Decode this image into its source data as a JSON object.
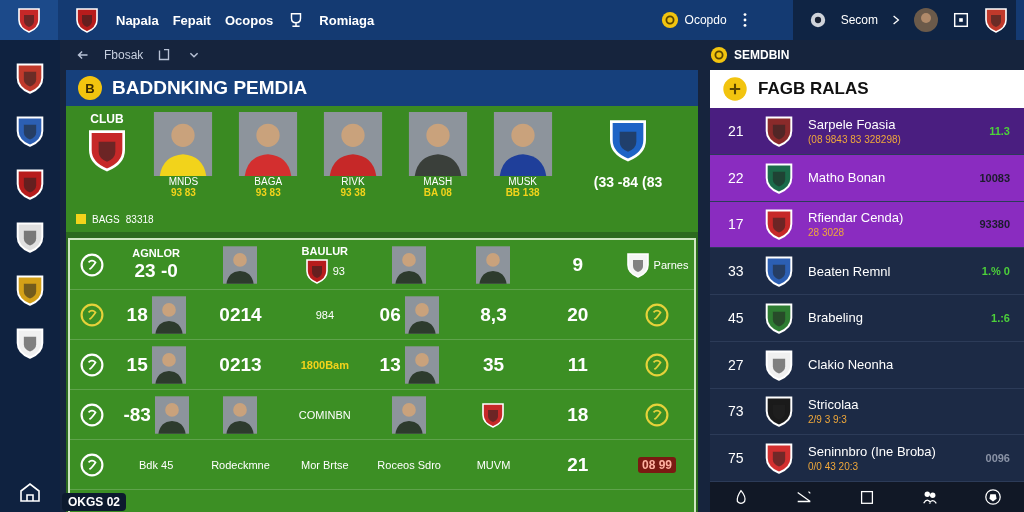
{
  "top_bar": {
    "nav": [
      "Napala",
      "Fepait",
      "Ocopos"
    ],
    "nav_extra": "Romiaga",
    "coins": "Ocopdo",
    "user": "Secom"
  },
  "sidebar": {
    "crests": [
      {
        "color": "#c0392b"
      },
      {
        "color": "#2c5fb3"
      },
      {
        "color": "#b71c1c"
      },
      {
        "color": "#e0e0e0"
      },
      {
        "color": "#d4a017"
      },
      {
        "color": "#f0f0f0"
      }
    ]
  },
  "sub_bar": {
    "title": "Fbosak",
    "right_label": "SEMDBIN"
  },
  "panel": {
    "title": "BADDNKING PEMDIA",
    "badge": "B",
    "hero": {
      "club_label": "CLUB",
      "club_crest": {
        "color": "#c62828"
      },
      "right_crest": {
        "color": "#1e63c6"
      },
      "footer_label": "BAGS",
      "footer_value": "83318",
      "score": "(33 -84 (83",
      "players": [
        {
          "name": "MNDS",
          "number": "93 83",
          "color": "#f2d31b"
        },
        {
          "name": "BAGA",
          "number": "93 83",
          "color": "#d32f2f"
        },
        {
          "name": "RIVK",
          "number": "93 38",
          "color": "#c62828"
        },
        {
          "name": "MASH",
          "number": "BA 08",
          "color": "#3a3f3a"
        },
        {
          "name": "MUSK",
          "number": "BB 138",
          "color": "#1f3f9a"
        }
      ]
    },
    "grid_rows": [
      [
        {
          "kind": "ring",
          "color": "#ffffff"
        },
        {
          "kind": "value",
          "caption": "AGNLOR",
          "text": "23 -0"
        },
        {
          "kind": "player"
        },
        {
          "kind": "crest",
          "caption": "BAULUR",
          "text": "93",
          "color": "#b71c1c"
        },
        {
          "kind": "player"
        },
        {
          "kind": "player"
        },
        {
          "kind": "value",
          "text": "9"
        },
        {
          "kind": "crest",
          "text": "Parnes",
          "color": "#f5f5f5"
        }
      ],
      [
        {
          "kind": "ring",
          "color": "#e6d23a"
        },
        {
          "kind": "player",
          "text": "18"
        },
        {
          "kind": "value",
          "text": "0214"
        },
        {
          "kind": "text",
          "text": "984"
        },
        {
          "kind": "player",
          "text": "06"
        },
        {
          "kind": "value",
          "text": "8,3"
        },
        {
          "kind": "value",
          "text": "20"
        },
        {
          "kind": "ring",
          "color": "#e6d23a"
        }
      ],
      [
        {
          "kind": "ring",
          "color": "#ffffff"
        },
        {
          "kind": "player",
          "text": "15"
        },
        {
          "kind": "value",
          "text": "0213"
        },
        {
          "kind": "note",
          "text": "1800Bam"
        },
        {
          "kind": "player",
          "text": "13"
        },
        {
          "kind": "value",
          "text": "35"
        },
        {
          "kind": "value",
          "text": "11"
        },
        {
          "kind": "ring",
          "color": "#e6d23a"
        }
      ],
      [
        {
          "kind": "ring",
          "color": "#ffffff"
        },
        {
          "kind": "player",
          "text": "-83"
        },
        {
          "kind": "player"
        },
        {
          "kind": "text",
          "text": "COMINBN"
        },
        {
          "kind": "player"
        },
        {
          "kind": "crest",
          "color": "#c62828"
        },
        {
          "kind": "value",
          "text": "18"
        },
        {
          "kind": "ring",
          "color": "#e6d23a"
        }
      ],
      [
        {
          "kind": "ring",
          "color": "#ffffff"
        },
        {
          "kind": "text",
          "text": "Bdk 45"
        },
        {
          "kind": "text",
          "text": "Rodeckmne"
        },
        {
          "kind": "text",
          "text": "Mor Brtse"
        },
        {
          "kind": "text",
          "text": "Roceos Sdro"
        },
        {
          "kind": "text",
          "text": "MUVM"
        },
        {
          "kind": "value",
          "text": "21"
        },
        {
          "kind": "alert",
          "text": "08 99"
        }
      ]
    ],
    "corner_badge": "OKGS 02"
  },
  "ranking": {
    "title": "FAGB RALAS",
    "rows": [
      {
        "rank": "21",
        "name": "Sarpele Foasia",
        "detail": "(08 9843 83 328298)",
        "value": "11.3",
        "color": "#4cd13a",
        "crest": {
          "color": "#8a2a2a"
        },
        "pinned": true,
        "selected": false
      },
      {
        "rank": "22",
        "name": "Matho Bonan",
        "value": "10083",
        "color": "#1c1c2c",
        "crest": {
          "color": "#1b6b4a"
        },
        "pinned": false,
        "selected": true
      },
      {
        "rank": "17",
        "name": "Rfiendar Cenda)",
        "detail": "28 3028",
        "value": "93380",
        "color": "#1c1c2c",
        "crest": {
          "color": "#c62828"
        },
        "pinned": false,
        "selected": true
      },
      {
        "rank": "33",
        "name": "Beaten Remnl",
        "value": "1.% 0",
        "color": "#4cd13a",
        "crest": {
          "color": "#2c5fb3"
        },
        "pinned": false,
        "selected": false
      },
      {
        "rank": "45",
        "name": "Brabeling",
        "value": "1.:6",
        "color": "#4cd13a",
        "crest": {
          "color": "#2e7d32"
        },
        "pinned": false,
        "selected": false
      },
      {
        "rank": "27",
        "name": "Clakio Neonha",
        "crest": {
          "color": "#f0f0f0"
        },
        "pinned": false,
        "selected": false
      },
      {
        "rank": "73",
        "name": "Stricolaa",
        "detail": "2/9 3 9:3",
        "crest": {
          "color": "#1a1a1a"
        },
        "pinned": false,
        "selected": false
      },
      {
        "rank": "75",
        "name": "Seninnbro (Ine Broba)",
        "detail": "0/0 43 20:3",
        "value": "0096",
        "color": "#8a93a6",
        "crest": {
          "color": "#d32f2f"
        },
        "pinned": false,
        "selected": false
      }
    ]
  }
}
